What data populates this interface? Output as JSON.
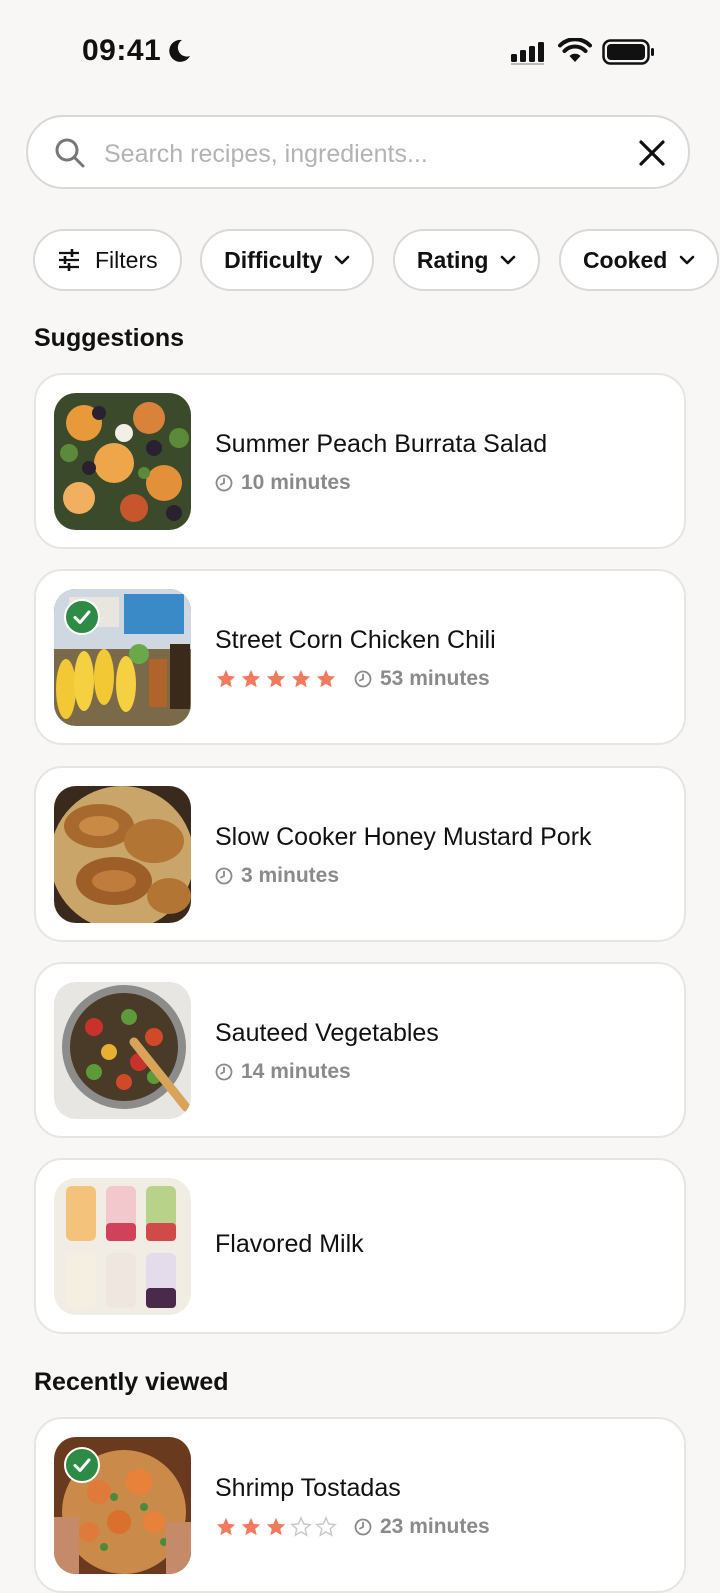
{
  "status_bar": {
    "time": "09:41"
  },
  "search": {
    "placeholder": "Search recipes, ingredients...",
    "value": ""
  },
  "filters": [
    {
      "label": "Filters"
    },
    {
      "label": "Difficulty"
    },
    {
      "label": "Rating"
    },
    {
      "label": "Cooked"
    }
  ],
  "sections": {
    "suggestions": "Suggestions",
    "recently_viewed": "Recently viewed"
  },
  "suggestions": [
    {
      "title": "Summer Peach Burrata Salad",
      "time": "10 minutes",
      "rating": null,
      "cooked": false
    },
    {
      "title": "Street Corn Chicken Chili",
      "time": "53 minutes",
      "rating": 5,
      "cooked": true
    },
    {
      "title": "Slow Cooker Honey Mustard Pork",
      "time": "3 minutes",
      "rating": null,
      "cooked": false
    },
    {
      "title": "Sauteed Vegetables",
      "time": "14 minutes",
      "rating": null,
      "cooked": false
    },
    {
      "title": "Flavored Milk",
      "time": null,
      "rating": null,
      "cooked": false
    }
  ],
  "recently_viewed": [
    {
      "title": "Shrimp Tostadas",
      "time": "23 minutes",
      "rating": 3,
      "cooked": true
    }
  ],
  "colors": {
    "star": "#ef7a5e",
    "star_empty": "#c9c9c9",
    "check": "#2e8b46",
    "meta": "#8a8a8a"
  },
  "icons": {
    "search": "search-icon",
    "clear": "close-icon",
    "filters": "sliders-icon",
    "chevron": "chevron-down-icon",
    "clock": "clock-icon",
    "star": "star-icon",
    "check": "checkmark-icon"
  }
}
